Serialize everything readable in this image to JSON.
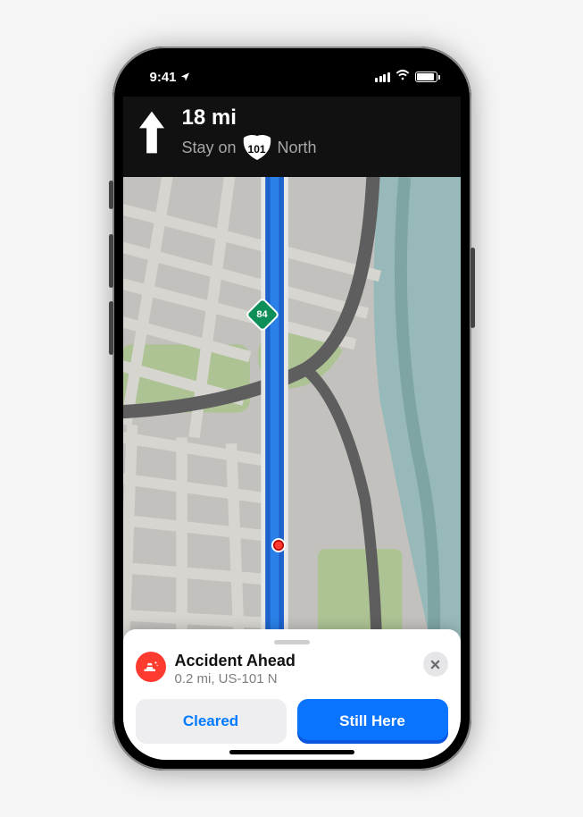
{
  "status": {
    "time": "9:41",
    "location_icon": "location-arrow",
    "signal_bars": 4,
    "wifi": "wifi-full",
    "battery": "battery-full"
  },
  "navigation": {
    "distance": "18 mi",
    "instruction_pre": "Stay on",
    "route_shield": "101",
    "instruction_post": "North",
    "arrow_icon": "arrow-up"
  },
  "map": {
    "highway_shield": "84",
    "incident_marker": "accident"
  },
  "incident_card": {
    "icon": "car-crash",
    "title": "Accident Ahead",
    "subtitle": "0.2 mi, US-101 N",
    "close_icon": "x",
    "button_secondary": "Cleared",
    "button_primary": "Still Here"
  },
  "colors": {
    "accent_blue": "#0a74ff",
    "link_blue": "#007aff",
    "danger_red": "#ff3b30",
    "shield_green": "#0e8f5a"
  }
}
